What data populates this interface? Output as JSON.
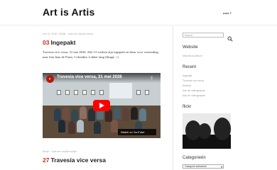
{
  "site": {
    "title": "Art is Artis",
    "nav_label": "over 7"
  },
  "post1": {
    "meta": "mei 31, 2026 · Bertje · Laat een reactie achter",
    "day": "03",
    "title": "Ingepakt",
    "body": "Travesia vice versa, 31 mei 2026. Alle 13 werken zijn ingepakt en klaar voor verzending naar San Juan de Pasto, Colombia. Lekker lang filmpje ;-)",
    "video": {
      "title": "Travesia vice versa, 31 mei 2026",
      "watch_label": "Watch on YouTube"
    }
  },
  "post2": {
    "meta": "Bertje · Laat een reactie achter",
    "day": "27",
    "title": "Travesía vice versa"
  },
  "sidebar": {
    "search_placeholder": "Search",
    "website_title": "Website",
    "website_link": "www.art-is-artis.nl",
    "recent_title": "Recent",
    "recent_items": [
      "Ingepakt",
      "Travesía vice versa",
      "Artobok",
      "Aan de videographie",
      "Aan de videographie"
    ],
    "flickr_title": "flickr",
    "categories_title": "Categorieën",
    "categories_select": "Categorie selecteren"
  },
  "colors": {
    "accent_red": "#d12a1a",
    "youtube_red": "#ff0000"
  }
}
